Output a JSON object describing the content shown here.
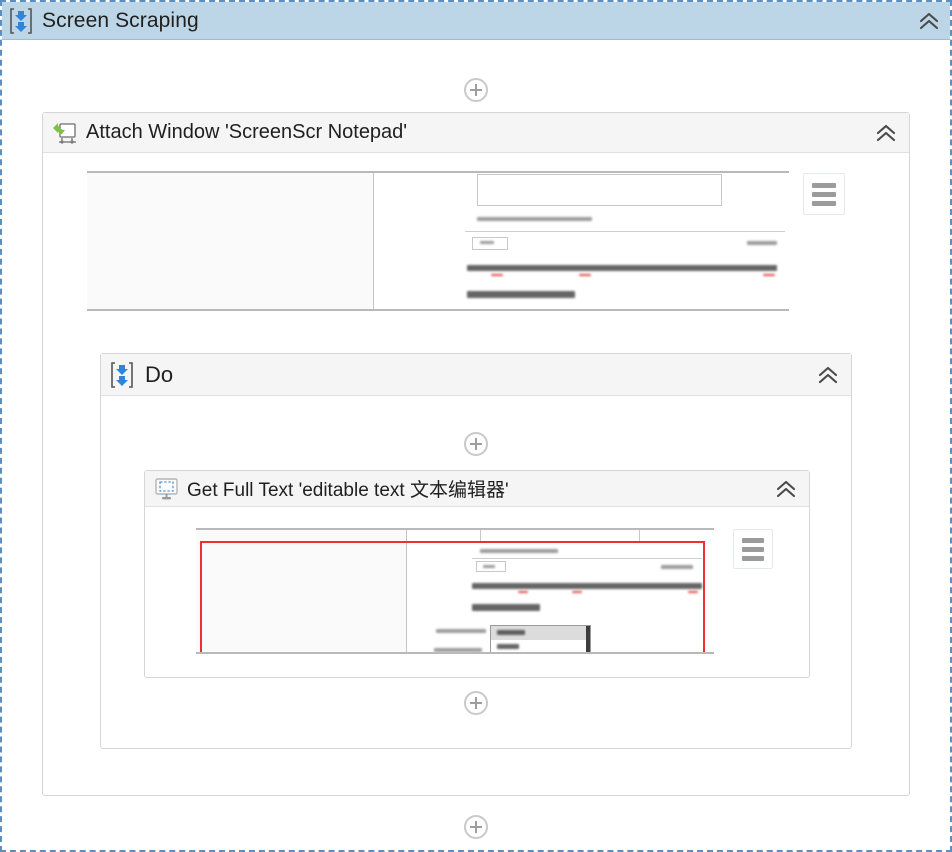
{
  "workflow": {
    "root": {
      "title": "Screen Scraping",
      "icon": "sequence-icon",
      "collapse_icon": "chevron-double-up-icon",
      "header_color": "#bcd6e8",
      "selected_border_color": "#5a8fc0"
    },
    "attach_window": {
      "title": "Attach Window 'ScreenScr Notepad'",
      "icon": "attach-window-icon",
      "collapse_icon": "chevron-double-up-icon",
      "icon_color": "#7cc142",
      "thumbnail": {
        "name": "informative-screenshot",
        "menu_icon": "hamburger-menu-icon"
      }
    },
    "do": {
      "title": "Do",
      "icon": "sequence-icon",
      "collapse_icon": "chevron-double-up-icon"
    },
    "get_full_text": {
      "title": "Get Full Text 'editable text  文本编辑器'",
      "icon": "screen-selection-icon",
      "collapse_icon": "chevron-double-up-icon",
      "thumbnail": {
        "name": "informative-screenshot",
        "menu_icon": "hamburger-menu-icon",
        "selection_color": "#f03030"
      }
    },
    "connectors": [
      {
        "name": "add-activity-top",
        "icon": "plus-circle-icon"
      },
      {
        "name": "add-activity-do-top",
        "icon": "plus-circle-icon"
      },
      {
        "name": "add-activity-do-bottom",
        "icon": "plus-circle-icon"
      },
      {
        "name": "add-activity-bottom",
        "icon": "plus-circle-icon"
      }
    ]
  }
}
